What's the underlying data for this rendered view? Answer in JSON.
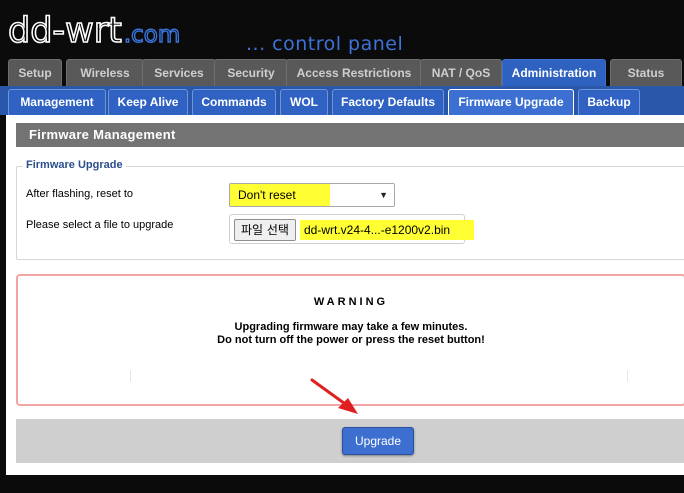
{
  "header": {
    "logo_main": "dd-wrt",
    "logo_suffix": ".com",
    "subtitle": "... control panel"
  },
  "main_tabs": [
    {
      "label": "Setup",
      "active": false
    },
    {
      "label": "Wireless",
      "active": false
    },
    {
      "label": "Services",
      "active": false
    },
    {
      "label": "Security",
      "active": false
    },
    {
      "label": "Access Restrictions",
      "active": false
    },
    {
      "label": "NAT / QoS",
      "active": false
    },
    {
      "label": "Administration",
      "active": true
    },
    {
      "label": "Status",
      "active": false
    }
  ],
  "sub_tabs": [
    {
      "label": "Management",
      "active": false
    },
    {
      "label": "Keep Alive",
      "active": false
    },
    {
      "label": "Commands",
      "active": false
    },
    {
      "label": "WOL",
      "active": false
    },
    {
      "label": "Factory Defaults",
      "active": false
    },
    {
      "label": "Firmware Upgrade",
      "active": true
    },
    {
      "label": "Backup",
      "active": false
    }
  ],
  "section": {
    "title": "Firmware Management",
    "fieldset_legend": "Firmware Upgrade",
    "reset_label": "After flashing, reset to",
    "reset_value": "Don't reset",
    "file_label": "Please select a file to upgrade",
    "file_button": "파일 선택",
    "file_name": "dd-wrt.v24-4...-e1200v2.bin"
  },
  "warning": {
    "title": "WARNING",
    "line1": "Upgrading firmware may take a few minutes.",
    "line2": "Do not turn off the power or press the reset button!"
  },
  "actions": {
    "upgrade_label": "Upgrade"
  },
  "colors": {
    "accent_blue": "#2f62c0",
    "highlight_yellow": "#ffff33",
    "annotation_red": "#e02020"
  }
}
